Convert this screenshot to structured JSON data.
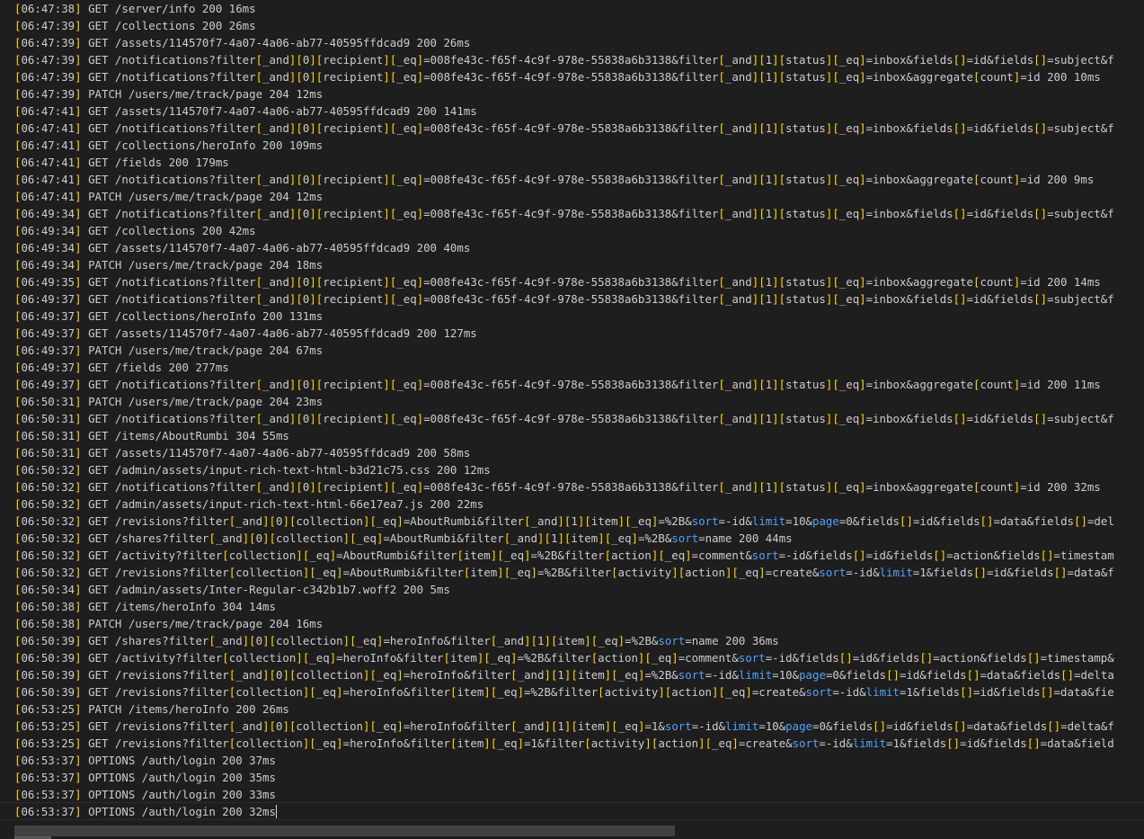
{
  "terminal": {
    "colors": {
      "background": "#1e1e1e",
      "text": "#cccccc",
      "bracket": "#ffd700",
      "keyword": "#4fa3ff"
    },
    "keywords": [
      "sort",
      "limit",
      "page",
      "aggregate"
    ],
    "lines": [
      "[06:47:38] GET /server/info 200 16ms",
      "[06:47:39] GET /collections 200 26ms",
      "[06:47:39] GET /assets/114570f7-4a07-4a06-ab77-40595ffdcad9 200 26ms",
      "[06:47:39] GET /notifications?filter[_and][0][recipient][_eq]=008fe43c-f65f-4c9f-978e-55838a6b3138&filter[_and][1][status][_eq]=inbox&fields[]=id&fields[]=subject&f",
      "[06:47:39] GET /notifications?filter[_and][0][recipient][_eq]=008fe43c-f65f-4c9f-978e-55838a6b3138&filter[_and][1][status][_eq]=inbox&aggregate[count]=id 200 10ms",
      "[06:47:39] PATCH /users/me/track/page 204 12ms",
      "[06:47:41] GET /assets/114570f7-4a07-4a06-ab77-40595ffdcad9 200 141ms",
      "[06:47:41] GET /notifications?filter[_and][0][recipient][_eq]=008fe43c-f65f-4c9f-978e-55838a6b3138&filter[_and][1][status][_eq]=inbox&fields[]=id&fields[]=subject&f",
      "[06:47:41] GET /collections/heroInfo 200 109ms",
      "[06:47:41] GET /fields 200 179ms",
      "[06:47:41] GET /notifications?filter[_and][0][recipient][_eq]=008fe43c-f65f-4c9f-978e-55838a6b3138&filter[_and][1][status][_eq]=inbox&aggregate[count]=id 200 9ms",
      "[06:47:41] PATCH /users/me/track/page 204 12ms",
      "[06:49:34] GET /notifications?filter[_and][0][recipient][_eq]=008fe43c-f65f-4c9f-978e-55838a6b3138&filter[_and][1][status][_eq]=inbox&fields[]=id&fields[]=subject&f",
      "[06:49:34] GET /collections 200 42ms",
      "[06:49:34] GET /assets/114570f7-4a07-4a06-ab77-40595ffdcad9 200 40ms",
      "[06:49:34] PATCH /users/me/track/page 204 18ms",
      "[06:49:35] GET /notifications?filter[_and][0][recipient][_eq]=008fe43c-f65f-4c9f-978e-55838a6b3138&filter[_and][1][status][_eq]=inbox&aggregate[count]=id 200 14ms",
      "[06:49:37] GET /notifications?filter[_and][0][recipient][_eq]=008fe43c-f65f-4c9f-978e-55838a6b3138&filter[_and][1][status][_eq]=inbox&fields[]=id&fields[]=subject&f",
      "[06:49:37] GET /collections/heroInfo 200 131ms",
      "[06:49:37] GET /assets/114570f7-4a07-4a06-ab77-40595ffdcad9 200 127ms",
      "[06:49:37] PATCH /users/me/track/page 204 67ms",
      "[06:49:37] GET /fields 200 277ms",
      "[06:49:37] GET /notifications?filter[_and][0][recipient][_eq]=008fe43c-f65f-4c9f-978e-55838a6b3138&filter[_and][1][status][_eq]=inbox&aggregate[count]=id 200 11ms",
      "[06:50:31] PATCH /users/me/track/page 204 23ms",
      "[06:50:31] GET /notifications?filter[_and][0][recipient][_eq]=008fe43c-f65f-4c9f-978e-55838a6b3138&filter[_and][1][status][_eq]=inbox&fields[]=id&fields[]=subject&f",
      "[06:50:31] GET /items/AboutRumbi 304 55ms",
      "[06:50:31] GET /assets/114570f7-4a07-4a06-ab77-40595ffdcad9 200 58ms",
      "[06:50:32] GET /admin/assets/input-rich-text-html-b3d21c75.css 200 12ms",
      "[06:50:32] GET /notifications?filter[_and][0][recipient][_eq]=008fe43c-f65f-4c9f-978e-55838a6b3138&filter[_and][1][status][_eq]=inbox&aggregate[count]=id 200 32ms",
      "[06:50:32] GET /admin/assets/input-rich-text-html-66e17ea7.js 200 22ms",
      "[06:50:32] GET /revisions?filter[_and][0][collection][_eq]=AboutRumbi&filter[_and][1][item][_eq]=%2B&sort=-id&limit=10&page=0&fields[]=id&fields[]=data&fields[]=del",
      "[06:50:32] GET /shares?filter[_and][0][collection][_eq]=AboutRumbi&filter[_and][1][item][_eq]=%2B&sort=name 200 44ms",
      "[06:50:32] GET /activity?filter[collection][_eq]=AboutRumbi&filter[item][_eq]=%2B&filter[action][_eq]=comment&sort=-id&fields[]=id&fields[]=action&fields[]=timestam",
      "[06:50:32] GET /revisions?filter[collection][_eq]=AboutRumbi&filter[item][_eq]=%2B&filter[activity][action][_eq]=create&sort=-id&limit=1&fields[]=id&fields[]=data&f",
      "[06:50:34] GET /admin/assets/Inter-Regular-c342b1b7.woff2 200 5ms",
      "[06:50:38] GET /items/heroInfo 304 14ms",
      "[06:50:38] PATCH /users/me/track/page 204 16ms",
      "[06:50:39] GET /shares?filter[_and][0][collection][_eq]=heroInfo&filter[_and][1][item][_eq]=%2B&sort=name 200 36ms",
      "[06:50:39] GET /activity?filter[collection][_eq]=heroInfo&filter[item][_eq]=%2B&filter[action][_eq]=comment&sort=-id&fields[]=id&fields[]=action&fields[]=timestamp&",
      "[06:50:39] GET /revisions?filter[_and][0][collection][_eq]=heroInfo&filter[_and][1][item][_eq]=%2B&sort=-id&limit=10&page=0&fields[]=id&fields[]=data&fields[]=delta",
      "[06:50:39] GET /revisions?filter[collection][_eq]=heroInfo&filter[item][_eq]=%2B&filter[activity][action][_eq]=create&sort=-id&limit=1&fields[]=id&fields[]=data&fie",
      "[06:53:25] PATCH /items/heroInfo 200 26ms",
      "[06:53:25] GET /revisions?filter[_and][0][collection][_eq]=heroInfo&filter[_and][1][item][_eq]=1&sort=-id&limit=10&page=0&fields[]=id&fields[]=data&fields[]=delta&f",
      "[06:53:25] GET /revisions?filter[collection][_eq]=heroInfo&filter[item][_eq]=1&filter[activity][action][_eq]=create&sort=-id&limit=1&fields[]=id&fields[]=data&field",
      "[06:53:37] OPTIONS /auth/login 200 37ms",
      "[06:53:37] OPTIONS /auth/login 200 35ms",
      "[06:53:37] OPTIONS /auth/login 200 33ms",
      "[06:53:37] OPTIONS /auth/login 200 32ms"
    ]
  }
}
